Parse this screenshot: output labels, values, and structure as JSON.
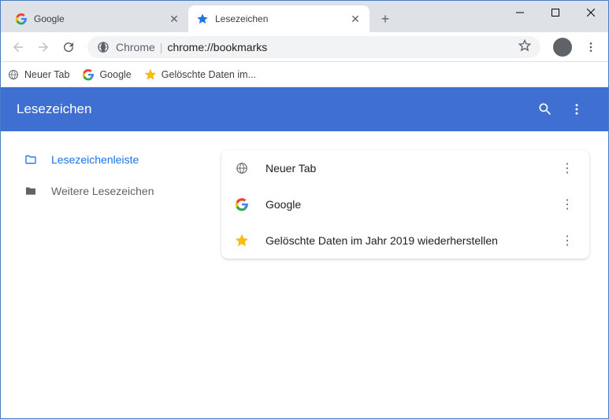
{
  "window": {
    "tabs": [
      {
        "title": "Google",
        "icon": "google"
      },
      {
        "title": "Lesezeichen",
        "icon": "star-blue"
      }
    ],
    "active_tab_index": 1
  },
  "toolbar": {
    "omnibox_prefix": "Chrome",
    "omnibox_url": "chrome://bookmarks"
  },
  "bookmarks_bar": [
    {
      "label": "Neuer Tab",
      "icon": "globe"
    },
    {
      "label": "Google",
      "icon": "google"
    },
    {
      "label": "Gelöschte Daten im...",
      "icon": "star-yellow"
    }
  ],
  "manager": {
    "title": "Lesezeichen",
    "sidebar": [
      {
        "label": "Lesezeichenleiste",
        "selected": true
      },
      {
        "label": "Weitere Lesezeichen",
        "selected": false
      }
    ],
    "items": [
      {
        "label": "Neuer Tab",
        "icon": "globe"
      },
      {
        "label": "Google",
        "icon": "google"
      },
      {
        "label": "Gelöschte Daten im Jahr 2019 wiederherstellen",
        "icon": "star-yellow"
      }
    ]
  }
}
